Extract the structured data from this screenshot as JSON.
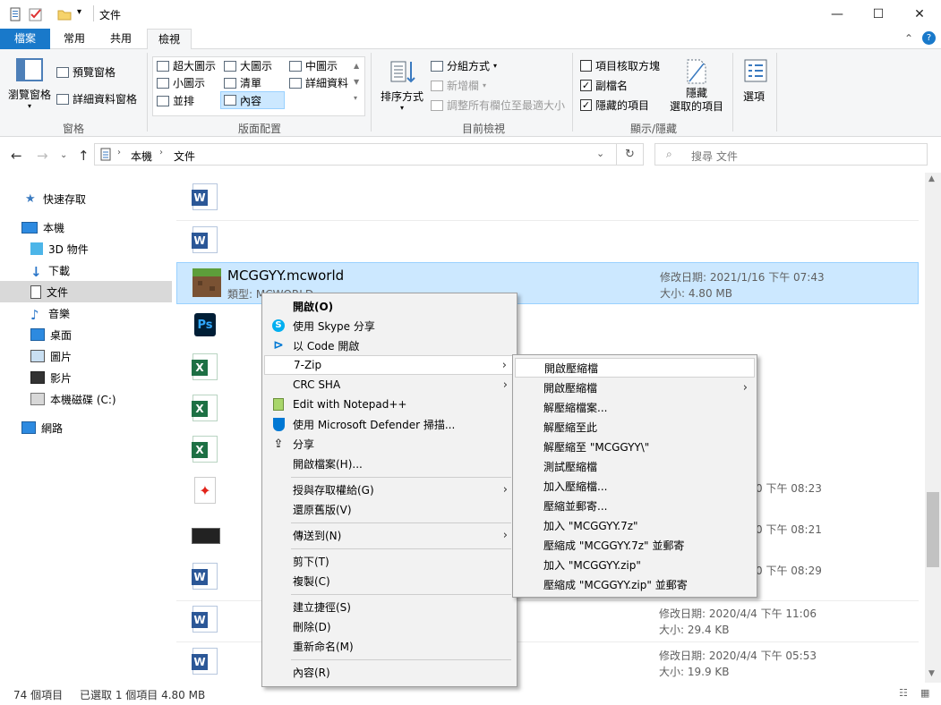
{
  "titlebar": {
    "title": "文件",
    "minimize": "—",
    "maximize": "☐",
    "close": "✕"
  },
  "ribbon_tabs": [
    "檔案",
    "常用",
    "共用",
    "檢視"
  ],
  "ribbon": {
    "panes": {
      "navpane": "瀏覽窗格",
      "preview": "預覽窗格",
      "details": "詳細資料窗格",
      "label": "窗格"
    },
    "layout": {
      "xl": "超大圖示",
      "large": "大圖示",
      "medium": "中圖示",
      "small": "小圖示",
      "list": "清單",
      "details": "詳細資料",
      "tiles": "並排",
      "content": "內容",
      "label": "版面配置"
    },
    "view": {
      "sort": "排序方式",
      "group": "分組方式",
      "add_col": "新增欄",
      "fit": "調整所有欄位至最適大小",
      "label": "目前檢視"
    },
    "showhide": {
      "checkboxes": "項目核取方塊",
      "extensions": "副檔名",
      "hidden": "隱藏的項目",
      "hide1": "隱藏",
      "hide2": "選取的項目",
      "label": "顯示/隱藏"
    },
    "options": "選項"
  },
  "address": {
    "crumbs": [
      "本機",
      "文件"
    ],
    "search_placeholder": "搜尋 文件"
  },
  "navpane": [
    {
      "label": "快速存取"
    },
    {
      "label": "本機"
    },
    {
      "label": "3D 物件"
    },
    {
      "label": "下載"
    },
    {
      "label": "文件"
    },
    {
      "label": "音樂"
    },
    {
      "label": "桌面"
    },
    {
      "label": "圖片"
    },
    {
      "label": "影片"
    },
    {
      "label": "本機磁碟 (C:)"
    },
    {
      "label": "網路"
    }
  ],
  "selected_file": {
    "name": "MCGGYY.mcworld",
    "type": "類型: MCWORLD",
    "modified": "修改日期: 2021/1/16 下午 07:43",
    "size": "大小: 4.80 MB"
  },
  "visible_meta": [
    {
      "date_frag": "0 下午 08:23"
    },
    {
      "date_frag": "0 下午 08:21"
    },
    {
      "date_frag": "0 下午 08:29"
    },
    {
      "modified": "修改日期: 2020/4/4 下午 11:06",
      "size": "大小: 29.4 KB"
    },
    {
      "modified": "修改日期: 2020/4/4 下午 05:53",
      "size": "大小: 19.9 KB"
    }
  ],
  "context_menu": [
    {
      "label": "開啟(O)",
      "bold": true
    },
    {
      "label": "使用 Skype 分享",
      "icon": "skype-icon"
    },
    {
      "label": "以 Code 開啟",
      "icon": "vscode-icon"
    },
    {
      "label": "7-Zip",
      "submenu": true,
      "highlight": true
    },
    {
      "label": "CRC SHA",
      "submenu": true
    },
    {
      "label": "Edit with Notepad++",
      "icon": "notepadpp-icon"
    },
    {
      "label": "使用 Microsoft Defender 掃描...",
      "icon": "defender-icon"
    },
    {
      "label": "分享",
      "icon": "share-icon"
    },
    {
      "label": "開啟檔案(H)..."
    },
    {
      "label": "授與存取權給(G)",
      "submenu": true
    },
    {
      "label": "還原舊版(V)"
    },
    {
      "label": "傳送到(N)",
      "submenu": true
    },
    {
      "label": "剪下(T)"
    },
    {
      "label": "複製(C)"
    },
    {
      "label": "建立捷徑(S)"
    },
    {
      "label": "刪除(D)"
    },
    {
      "label": "重新命名(M)"
    },
    {
      "label": "內容(R)"
    }
  ],
  "zip_menu": [
    "開啟壓縮檔",
    "開啟壓縮檔",
    "解壓縮檔案...",
    "解壓縮至此",
    "解壓縮至 \"MCGGYY\\\"",
    "測試壓縮檔",
    "加入壓縮檔...",
    "壓縮並郵寄...",
    "加入 \"MCGGYY.7z\"",
    "壓縮成 \"MCGGYY.7z\" 並郵寄",
    "加入 \"MCGGYY.zip\"",
    "壓縮成 \"MCGGYY.zip\" 並郵寄"
  ],
  "status": {
    "count": "74 個項目",
    "selected": "已選取 1 個項目 4.80 MB"
  },
  "colors": {
    "accent": "#1979ca",
    "selection": "#cce8ff",
    "selection_border": "#99d1ff"
  }
}
